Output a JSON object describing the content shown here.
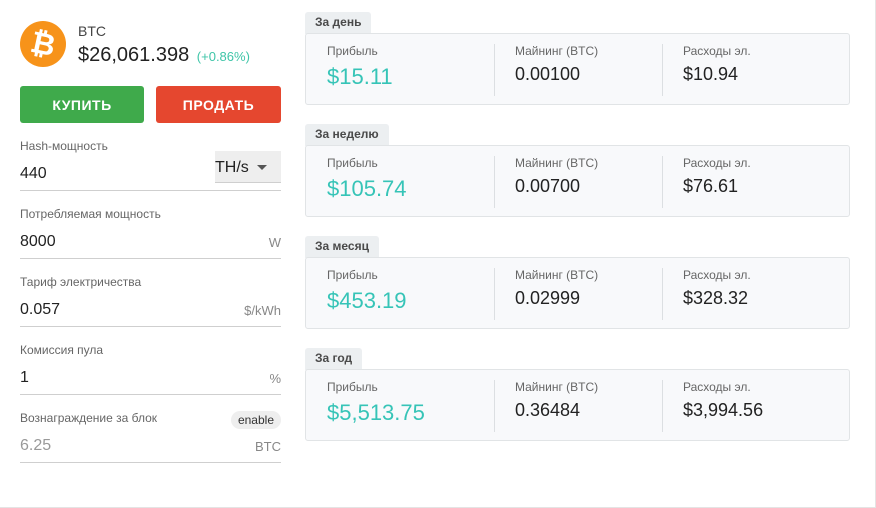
{
  "coin": {
    "symbol": "BTC",
    "price": "$26,061.398",
    "change": "(+0.86%)",
    "logo_icon": "bitcoin-icon",
    "logo_color": "#f7931a"
  },
  "actions": {
    "buy_label": "КУПИТЬ",
    "sell_label": "ПРОДАТЬ",
    "buy_color": "#3faa4b",
    "sell_color": "#e5472f"
  },
  "form": {
    "hashrate": {
      "label": "Hash-мощность",
      "value": "440",
      "unit": "TH/s"
    },
    "power": {
      "label": "Потребляемая мощность",
      "value": "8000",
      "unit": "W"
    },
    "tariff": {
      "label": "Тариф электричества",
      "value": "0.057",
      "unit": "$/kWh"
    },
    "pool_fee": {
      "label": "Комиссия пула",
      "value": "1",
      "unit": "%"
    },
    "block_reward": {
      "label": "Вознаграждение за блок",
      "value": "6.25",
      "unit": "BTC",
      "toggle_label": "enable"
    }
  },
  "results": [
    {
      "period": "За день",
      "profit_label": "Прибыль",
      "profit": "$15.11",
      "mining_label": "Майнинг (BTC)",
      "mining": "0.00100",
      "cost_label": "Расходы эл.",
      "cost": "$10.94"
    },
    {
      "period": "За неделю",
      "profit_label": "Прибыль",
      "profit": "$105.74",
      "mining_label": "Майнинг (BTC)",
      "mining": "0.00700",
      "cost_label": "Расходы эл.",
      "cost": "$76.61"
    },
    {
      "period": "За месяц",
      "profit_label": "Прибыль",
      "profit": "$453.19",
      "mining_label": "Майнинг (BTC)",
      "mining": "0.02999",
      "cost_label": "Расходы эл.",
      "cost": "$328.32"
    },
    {
      "period": "За год",
      "profit_label": "Прибыль",
      "profit": "$5,513.75",
      "mining_label": "Майнинг (BTC)",
      "mining": "0.36484",
      "cost_label": "Расходы эл.",
      "cost": "$3,994.56"
    }
  ],
  "colors": {
    "profit": "#36c4b7",
    "change": "#3fc5a8"
  }
}
